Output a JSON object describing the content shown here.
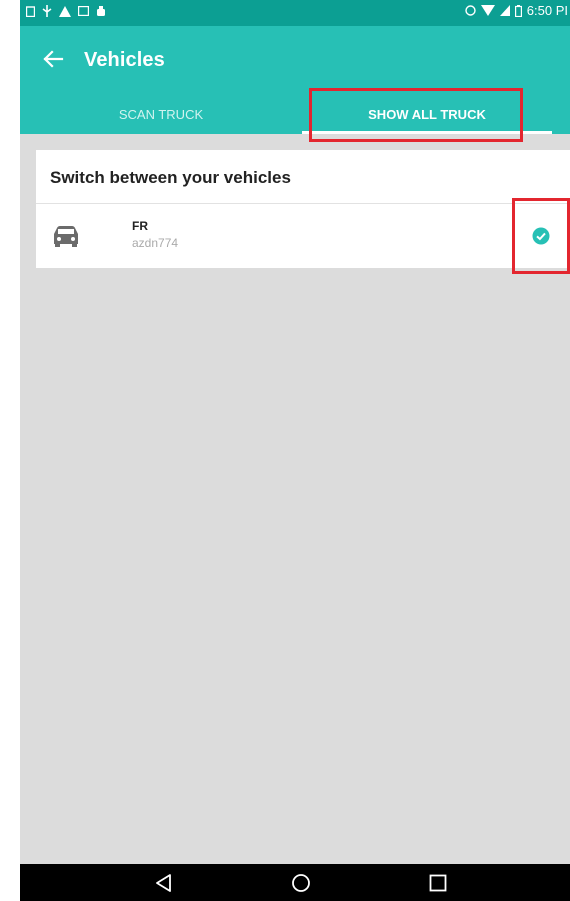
{
  "status_bar": {
    "time": "6:50 PI"
  },
  "app_bar": {
    "back_icon": "arrow-left-icon",
    "title": "Vehicles",
    "tabs": [
      {
        "label": "SCAN TRUCK",
        "selected": false
      },
      {
        "label": "SHOW ALL TRUCK",
        "selected": true
      }
    ]
  },
  "card": {
    "title": "Switch between your vehicles",
    "vehicles": [
      {
        "name": "FR",
        "plate": "azdn774",
        "icon": "car-icon",
        "selected": true
      }
    ]
  },
  "navigation_bar": {
    "buttons": [
      "back-triangle-icon",
      "home-circle-icon",
      "recents-square-icon"
    ]
  },
  "colors": {
    "status_bar": "#0c9f93",
    "app_bar": "#27c0b5",
    "accent": "#27c0b5",
    "highlight": "#e3262f",
    "background": "#dcdcdc"
  }
}
